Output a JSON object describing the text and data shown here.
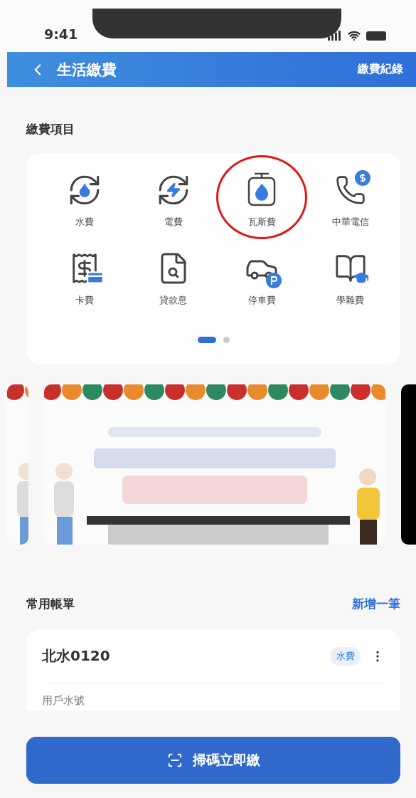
{
  "status_bar": {
    "time": "9:41"
  },
  "header": {
    "title": "生活繳費",
    "action": "繳費紀錄"
  },
  "payment_items": {
    "title": "繳費項目",
    "items": [
      {
        "label": "水費",
        "highlighted": false
      },
      {
        "label": "電費",
        "highlighted": false
      },
      {
        "label": "瓦斯費",
        "highlighted": true
      },
      {
        "label": "中華電信",
        "highlighted": false
      },
      {
        "label": "卡費",
        "highlighted": false
      },
      {
        "label": "貸款息",
        "highlighted": false
      },
      {
        "label": "停車費",
        "highlighted": false
      },
      {
        "label": "學雜費",
        "highlighted": false
      }
    ],
    "pages": [
      {
        "selected": true
      },
      {
        "selected": false
      }
    ]
  },
  "bills": {
    "title": "常用帳單",
    "action": "新增一筆",
    "items": [
      {
        "name": "北水0120",
        "tag": "水費",
        "field_label": "用戶水號"
      }
    ]
  },
  "scan_button": "掃碼立即繳"
}
